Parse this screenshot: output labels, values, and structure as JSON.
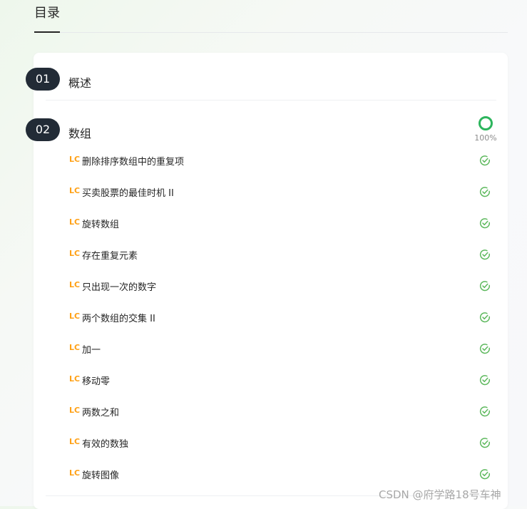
{
  "header": {
    "title": "目录"
  },
  "chapters": [
    {
      "number": "01",
      "title": "概述"
    },
    {
      "number": "02",
      "title": "数组",
      "progress_label": "100%",
      "progress_fraction": 1.0
    }
  ],
  "problems": [
    {
      "tag": "LC",
      "title": "删除排序数组中的重复项"
    },
    {
      "tag": "LC",
      "title": "买卖股票的最佳时机 II"
    },
    {
      "tag": "LC",
      "title": "旋转数组"
    },
    {
      "tag": "LC",
      "title": "存在重复元素"
    },
    {
      "tag": "LC",
      "title": "只出现一次的数字"
    },
    {
      "tag": "LC",
      "title": "两个数组的交集 II"
    },
    {
      "tag": "LC",
      "title": "加一"
    },
    {
      "tag": "LC",
      "title": "移动零"
    },
    {
      "tag": "LC",
      "title": "两数之和"
    },
    {
      "tag": "LC",
      "title": "有效的数独"
    },
    {
      "tag": "LC",
      "title": "旋转图像"
    }
  ],
  "status_icon": "check-circle-icon",
  "colors": {
    "lc_tag": "#ffa116",
    "check": "#5cb85c",
    "progress": "#2db55d",
    "badge_bg": "#222b36"
  },
  "watermark": "CSDN @府学路18号车神"
}
